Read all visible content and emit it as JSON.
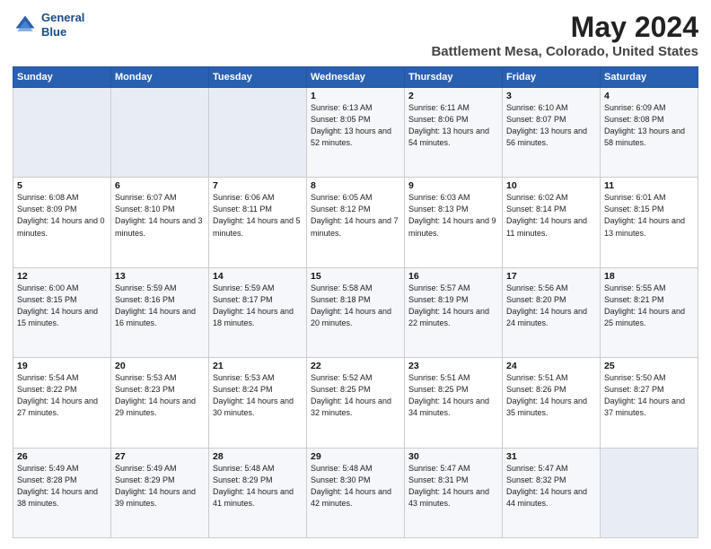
{
  "header": {
    "logo_line1": "General",
    "logo_line2": "Blue",
    "title": "May 2024",
    "subtitle": "Battlement Mesa, Colorado, United States"
  },
  "weekdays": [
    "Sunday",
    "Monday",
    "Tuesday",
    "Wednesday",
    "Thursday",
    "Friday",
    "Saturday"
  ],
  "weeks": [
    [
      {
        "day": "",
        "sunrise": "",
        "sunset": "",
        "daylight": ""
      },
      {
        "day": "",
        "sunrise": "",
        "sunset": "",
        "daylight": ""
      },
      {
        "day": "",
        "sunrise": "",
        "sunset": "",
        "daylight": ""
      },
      {
        "day": "1",
        "sunrise": "Sunrise: 6:13 AM",
        "sunset": "Sunset: 8:05 PM",
        "daylight": "Daylight: 13 hours and 52 minutes."
      },
      {
        "day": "2",
        "sunrise": "Sunrise: 6:11 AM",
        "sunset": "Sunset: 8:06 PM",
        "daylight": "Daylight: 13 hours and 54 minutes."
      },
      {
        "day": "3",
        "sunrise": "Sunrise: 6:10 AM",
        "sunset": "Sunset: 8:07 PM",
        "daylight": "Daylight: 13 hours and 56 minutes."
      },
      {
        "day": "4",
        "sunrise": "Sunrise: 6:09 AM",
        "sunset": "Sunset: 8:08 PM",
        "daylight": "Daylight: 13 hours and 58 minutes."
      }
    ],
    [
      {
        "day": "5",
        "sunrise": "Sunrise: 6:08 AM",
        "sunset": "Sunset: 8:09 PM",
        "daylight": "Daylight: 14 hours and 0 minutes."
      },
      {
        "day": "6",
        "sunrise": "Sunrise: 6:07 AM",
        "sunset": "Sunset: 8:10 PM",
        "daylight": "Daylight: 14 hours and 3 minutes."
      },
      {
        "day": "7",
        "sunrise": "Sunrise: 6:06 AM",
        "sunset": "Sunset: 8:11 PM",
        "daylight": "Daylight: 14 hours and 5 minutes."
      },
      {
        "day": "8",
        "sunrise": "Sunrise: 6:05 AM",
        "sunset": "Sunset: 8:12 PM",
        "daylight": "Daylight: 14 hours and 7 minutes."
      },
      {
        "day": "9",
        "sunrise": "Sunrise: 6:03 AM",
        "sunset": "Sunset: 8:13 PM",
        "daylight": "Daylight: 14 hours and 9 minutes."
      },
      {
        "day": "10",
        "sunrise": "Sunrise: 6:02 AM",
        "sunset": "Sunset: 8:14 PM",
        "daylight": "Daylight: 14 hours and 11 minutes."
      },
      {
        "day": "11",
        "sunrise": "Sunrise: 6:01 AM",
        "sunset": "Sunset: 8:15 PM",
        "daylight": "Daylight: 14 hours and 13 minutes."
      }
    ],
    [
      {
        "day": "12",
        "sunrise": "Sunrise: 6:00 AM",
        "sunset": "Sunset: 8:15 PM",
        "daylight": "Daylight: 14 hours and 15 minutes."
      },
      {
        "day": "13",
        "sunrise": "Sunrise: 5:59 AM",
        "sunset": "Sunset: 8:16 PM",
        "daylight": "Daylight: 14 hours and 16 minutes."
      },
      {
        "day": "14",
        "sunrise": "Sunrise: 5:59 AM",
        "sunset": "Sunset: 8:17 PM",
        "daylight": "Daylight: 14 hours and 18 minutes."
      },
      {
        "day": "15",
        "sunrise": "Sunrise: 5:58 AM",
        "sunset": "Sunset: 8:18 PM",
        "daylight": "Daylight: 14 hours and 20 minutes."
      },
      {
        "day": "16",
        "sunrise": "Sunrise: 5:57 AM",
        "sunset": "Sunset: 8:19 PM",
        "daylight": "Daylight: 14 hours and 22 minutes."
      },
      {
        "day": "17",
        "sunrise": "Sunrise: 5:56 AM",
        "sunset": "Sunset: 8:20 PM",
        "daylight": "Daylight: 14 hours and 24 minutes."
      },
      {
        "day": "18",
        "sunrise": "Sunrise: 5:55 AM",
        "sunset": "Sunset: 8:21 PM",
        "daylight": "Daylight: 14 hours and 25 minutes."
      }
    ],
    [
      {
        "day": "19",
        "sunrise": "Sunrise: 5:54 AM",
        "sunset": "Sunset: 8:22 PM",
        "daylight": "Daylight: 14 hours and 27 minutes."
      },
      {
        "day": "20",
        "sunrise": "Sunrise: 5:53 AM",
        "sunset": "Sunset: 8:23 PM",
        "daylight": "Daylight: 14 hours and 29 minutes."
      },
      {
        "day": "21",
        "sunrise": "Sunrise: 5:53 AM",
        "sunset": "Sunset: 8:24 PM",
        "daylight": "Daylight: 14 hours and 30 minutes."
      },
      {
        "day": "22",
        "sunrise": "Sunrise: 5:52 AM",
        "sunset": "Sunset: 8:25 PM",
        "daylight": "Daylight: 14 hours and 32 minutes."
      },
      {
        "day": "23",
        "sunrise": "Sunrise: 5:51 AM",
        "sunset": "Sunset: 8:25 PM",
        "daylight": "Daylight: 14 hours and 34 minutes."
      },
      {
        "day": "24",
        "sunrise": "Sunrise: 5:51 AM",
        "sunset": "Sunset: 8:26 PM",
        "daylight": "Daylight: 14 hours and 35 minutes."
      },
      {
        "day": "25",
        "sunrise": "Sunrise: 5:50 AM",
        "sunset": "Sunset: 8:27 PM",
        "daylight": "Daylight: 14 hours and 37 minutes."
      }
    ],
    [
      {
        "day": "26",
        "sunrise": "Sunrise: 5:49 AM",
        "sunset": "Sunset: 8:28 PM",
        "daylight": "Daylight: 14 hours and 38 minutes."
      },
      {
        "day": "27",
        "sunrise": "Sunrise: 5:49 AM",
        "sunset": "Sunset: 8:29 PM",
        "daylight": "Daylight: 14 hours and 39 minutes."
      },
      {
        "day": "28",
        "sunrise": "Sunrise: 5:48 AM",
        "sunset": "Sunset: 8:29 PM",
        "daylight": "Daylight: 14 hours and 41 minutes."
      },
      {
        "day": "29",
        "sunrise": "Sunrise: 5:48 AM",
        "sunset": "Sunset: 8:30 PM",
        "daylight": "Daylight: 14 hours and 42 minutes."
      },
      {
        "day": "30",
        "sunrise": "Sunrise: 5:47 AM",
        "sunset": "Sunset: 8:31 PM",
        "daylight": "Daylight: 14 hours and 43 minutes."
      },
      {
        "day": "31",
        "sunrise": "Sunrise: 5:47 AM",
        "sunset": "Sunset: 8:32 PM",
        "daylight": "Daylight: 14 hours and 44 minutes."
      },
      {
        "day": "",
        "sunrise": "",
        "sunset": "",
        "daylight": ""
      }
    ]
  ]
}
